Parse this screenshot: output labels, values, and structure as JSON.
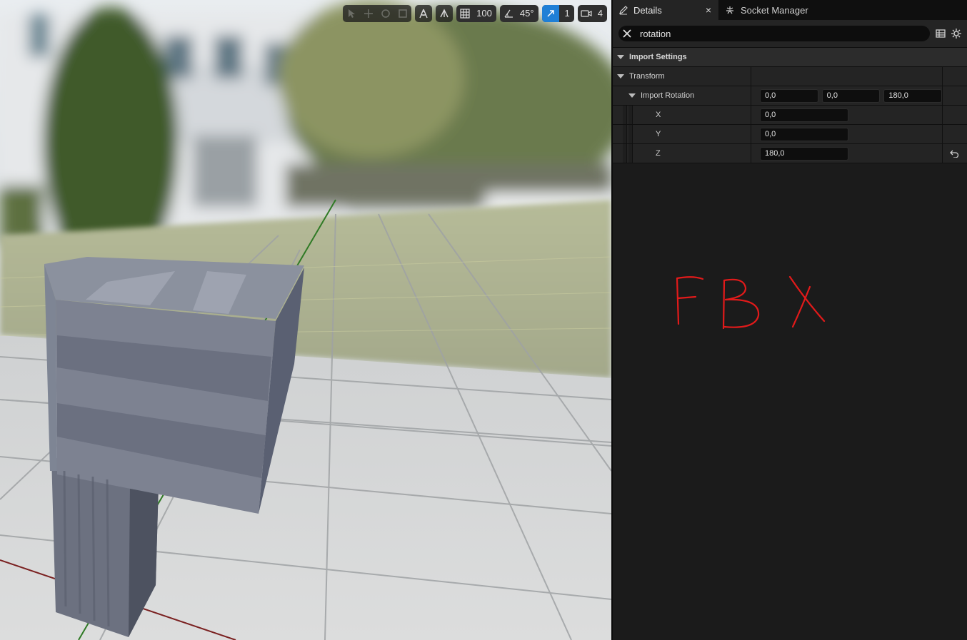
{
  "viewport": {
    "toolbar": {
      "grid_snap_value": "100",
      "rotation_snap_value": "45°",
      "scale_snap_value": "1",
      "camera_speed_value": "4"
    }
  },
  "details_panel": {
    "tabs": [
      {
        "label": "Details",
        "icon": "pencil-icon",
        "active": true
      },
      {
        "label": "Socket Manager",
        "icon": "socket-icon",
        "active": false
      }
    ],
    "search": {
      "value": "rotation"
    },
    "sections": {
      "import_settings": "Import Settings",
      "transform": "Transform",
      "import_rotation": {
        "label": "Import Rotation",
        "x": "0,0",
        "y": "0,0",
        "z": "180,0"
      },
      "x_label": "X",
      "x_value": "0,0",
      "y_label": "Y",
      "y_value": "0,0",
      "z_label": "Z",
      "z_value": "180,0"
    },
    "annotation": "FBX"
  },
  "colors": {
    "accent": "#1f7fd6",
    "annotation_red": "#e21a1a",
    "panel_bg": "#1b1b1b"
  }
}
